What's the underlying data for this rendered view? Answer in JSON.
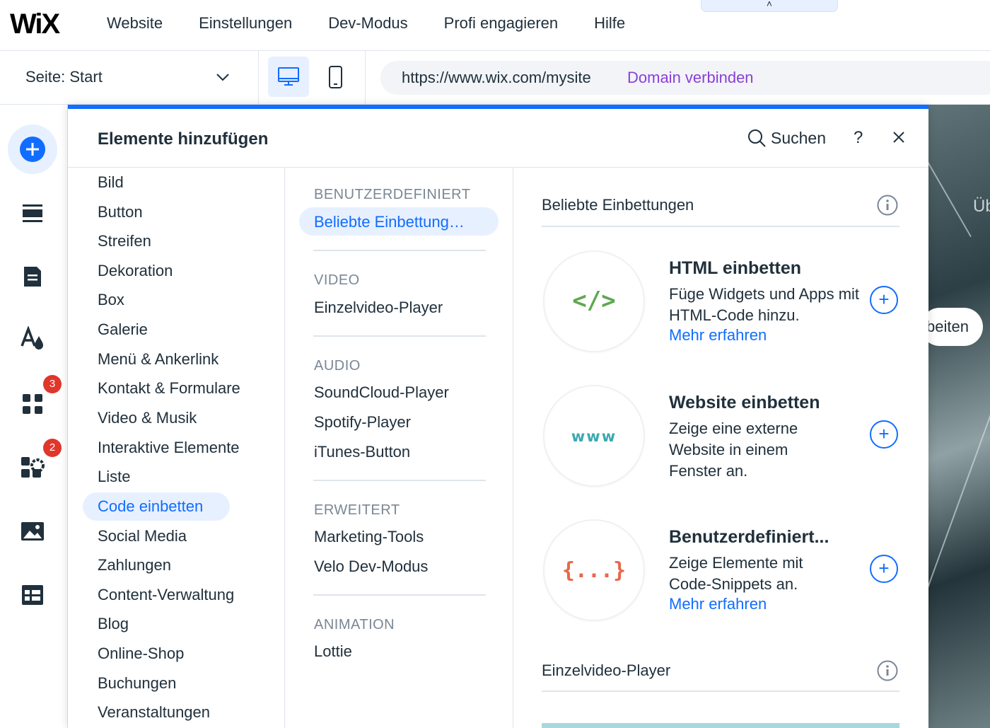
{
  "brand": {
    "logo": "WiX",
    "accent": "#116dff",
    "link_purple": "#8a3fd8",
    "badge_red": "#e0362c"
  },
  "top_nav": [
    "Website",
    "Einstellungen",
    "Dev-Modus",
    "Profi engagieren",
    "Hilfe"
  ],
  "collapse_tab": "˄",
  "page_selector": {
    "label": "Seite: Start",
    "icon": "chevron-down-icon"
  },
  "device_toggle": {
    "desktop_icon": "desktop-icon",
    "mobile_icon": "mobile-icon",
    "selected": "desktop"
  },
  "url_bar": {
    "url": "https://www.wix.com/mysite",
    "connect_label": "Domain verbinden"
  },
  "rail": [
    {
      "name": "add-elements",
      "icon": "plus-icon"
    },
    {
      "name": "sections",
      "icon": "sections-icon"
    },
    {
      "name": "pages",
      "icon": "pages-icon"
    },
    {
      "name": "design",
      "icon": "theme-icon"
    },
    {
      "name": "apps",
      "icon": "apps-icon",
      "badge": "3"
    },
    {
      "name": "business",
      "icon": "business-apps-icon",
      "badge": "2"
    },
    {
      "name": "media",
      "icon": "media-icon"
    },
    {
      "name": "cms",
      "icon": "table-icon"
    }
  ],
  "panel": {
    "title": "Elemente hinzufügen",
    "search_label": "Suchen",
    "help_label": "?",
    "categories": [
      "Bild",
      "Button",
      "Streifen",
      "Dekoration",
      "Box",
      "Galerie",
      "Menü & Ankerlink",
      "Kontakt & Formulare",
      "Video & Musik",
      "Interaktive Elemente",
      "Liste",
      "Code einbetten",
      "Social Media",
      "Zahlungen",
      "Content-Verwaltung",
      "Blog",
      "Online-Shop",
      "Buchungen",
      "Veranstaltungen"
    ],
    "active_category": "Code einbetten",
    "sections": [
      {
        "title": "BENUTZERDEFINIERT",
        "items": [
          "Beliebte Einbettung…"
        ]
      },
      {
        "title": "VIDEO",
        "items": [
          "Einzelvideo-Player"
        ]
      },
      {
        "title": "AUDIO",
        "items": [
          "SoundCloud-Player",
          "Spotify-Player",
          "iTunes-Button"
        ]
      },
      {
        "title": "ERWEITERT",
        "items": [
          "Marketing-Tools",
          "Velo Dev-Modus"
        ]
      },
      {
        "title": "ANIMATION",
        "items": [
          "Lottie"
        ]
      }
    ],
    "active_item": "Beliebte Einbettung…",
    "content": {
      "group1_title": "Beliebte Einbettungen",
      "cards": [
        {
          "title": "HTML einbetten",
          "desc": "Füge Widgets und Apps mit HTML-Code hinzu.",
          "link": "Mehr erfahren",
          "icon_text": "</>",
          "icon_color": "#5fa84f"
        },
        {
          "title": "Website einbetten",
          "desc": "Zeige eine externe Website in einem Fenster an.",
          "link": "",
          "icon_text": "www",
          "icon_color": "#3aa9b0"
        },
        {
          "title": "Benutzerdefiniert...",
          "desc": "Zeige Elemente mit Code-Snippets an.",
          "link": "Mehr erfahren",
          "icon_text": "{...}",
          "icon_color": "#e8674a"
        }
      ],
      "add_symbol": "+",
      "group2_title": "Einzelvideo-Player"
    }
  },
  "preview": {
    "heading_fragment": "Üb",
    "button_fragment": "beiten"
  }
}
